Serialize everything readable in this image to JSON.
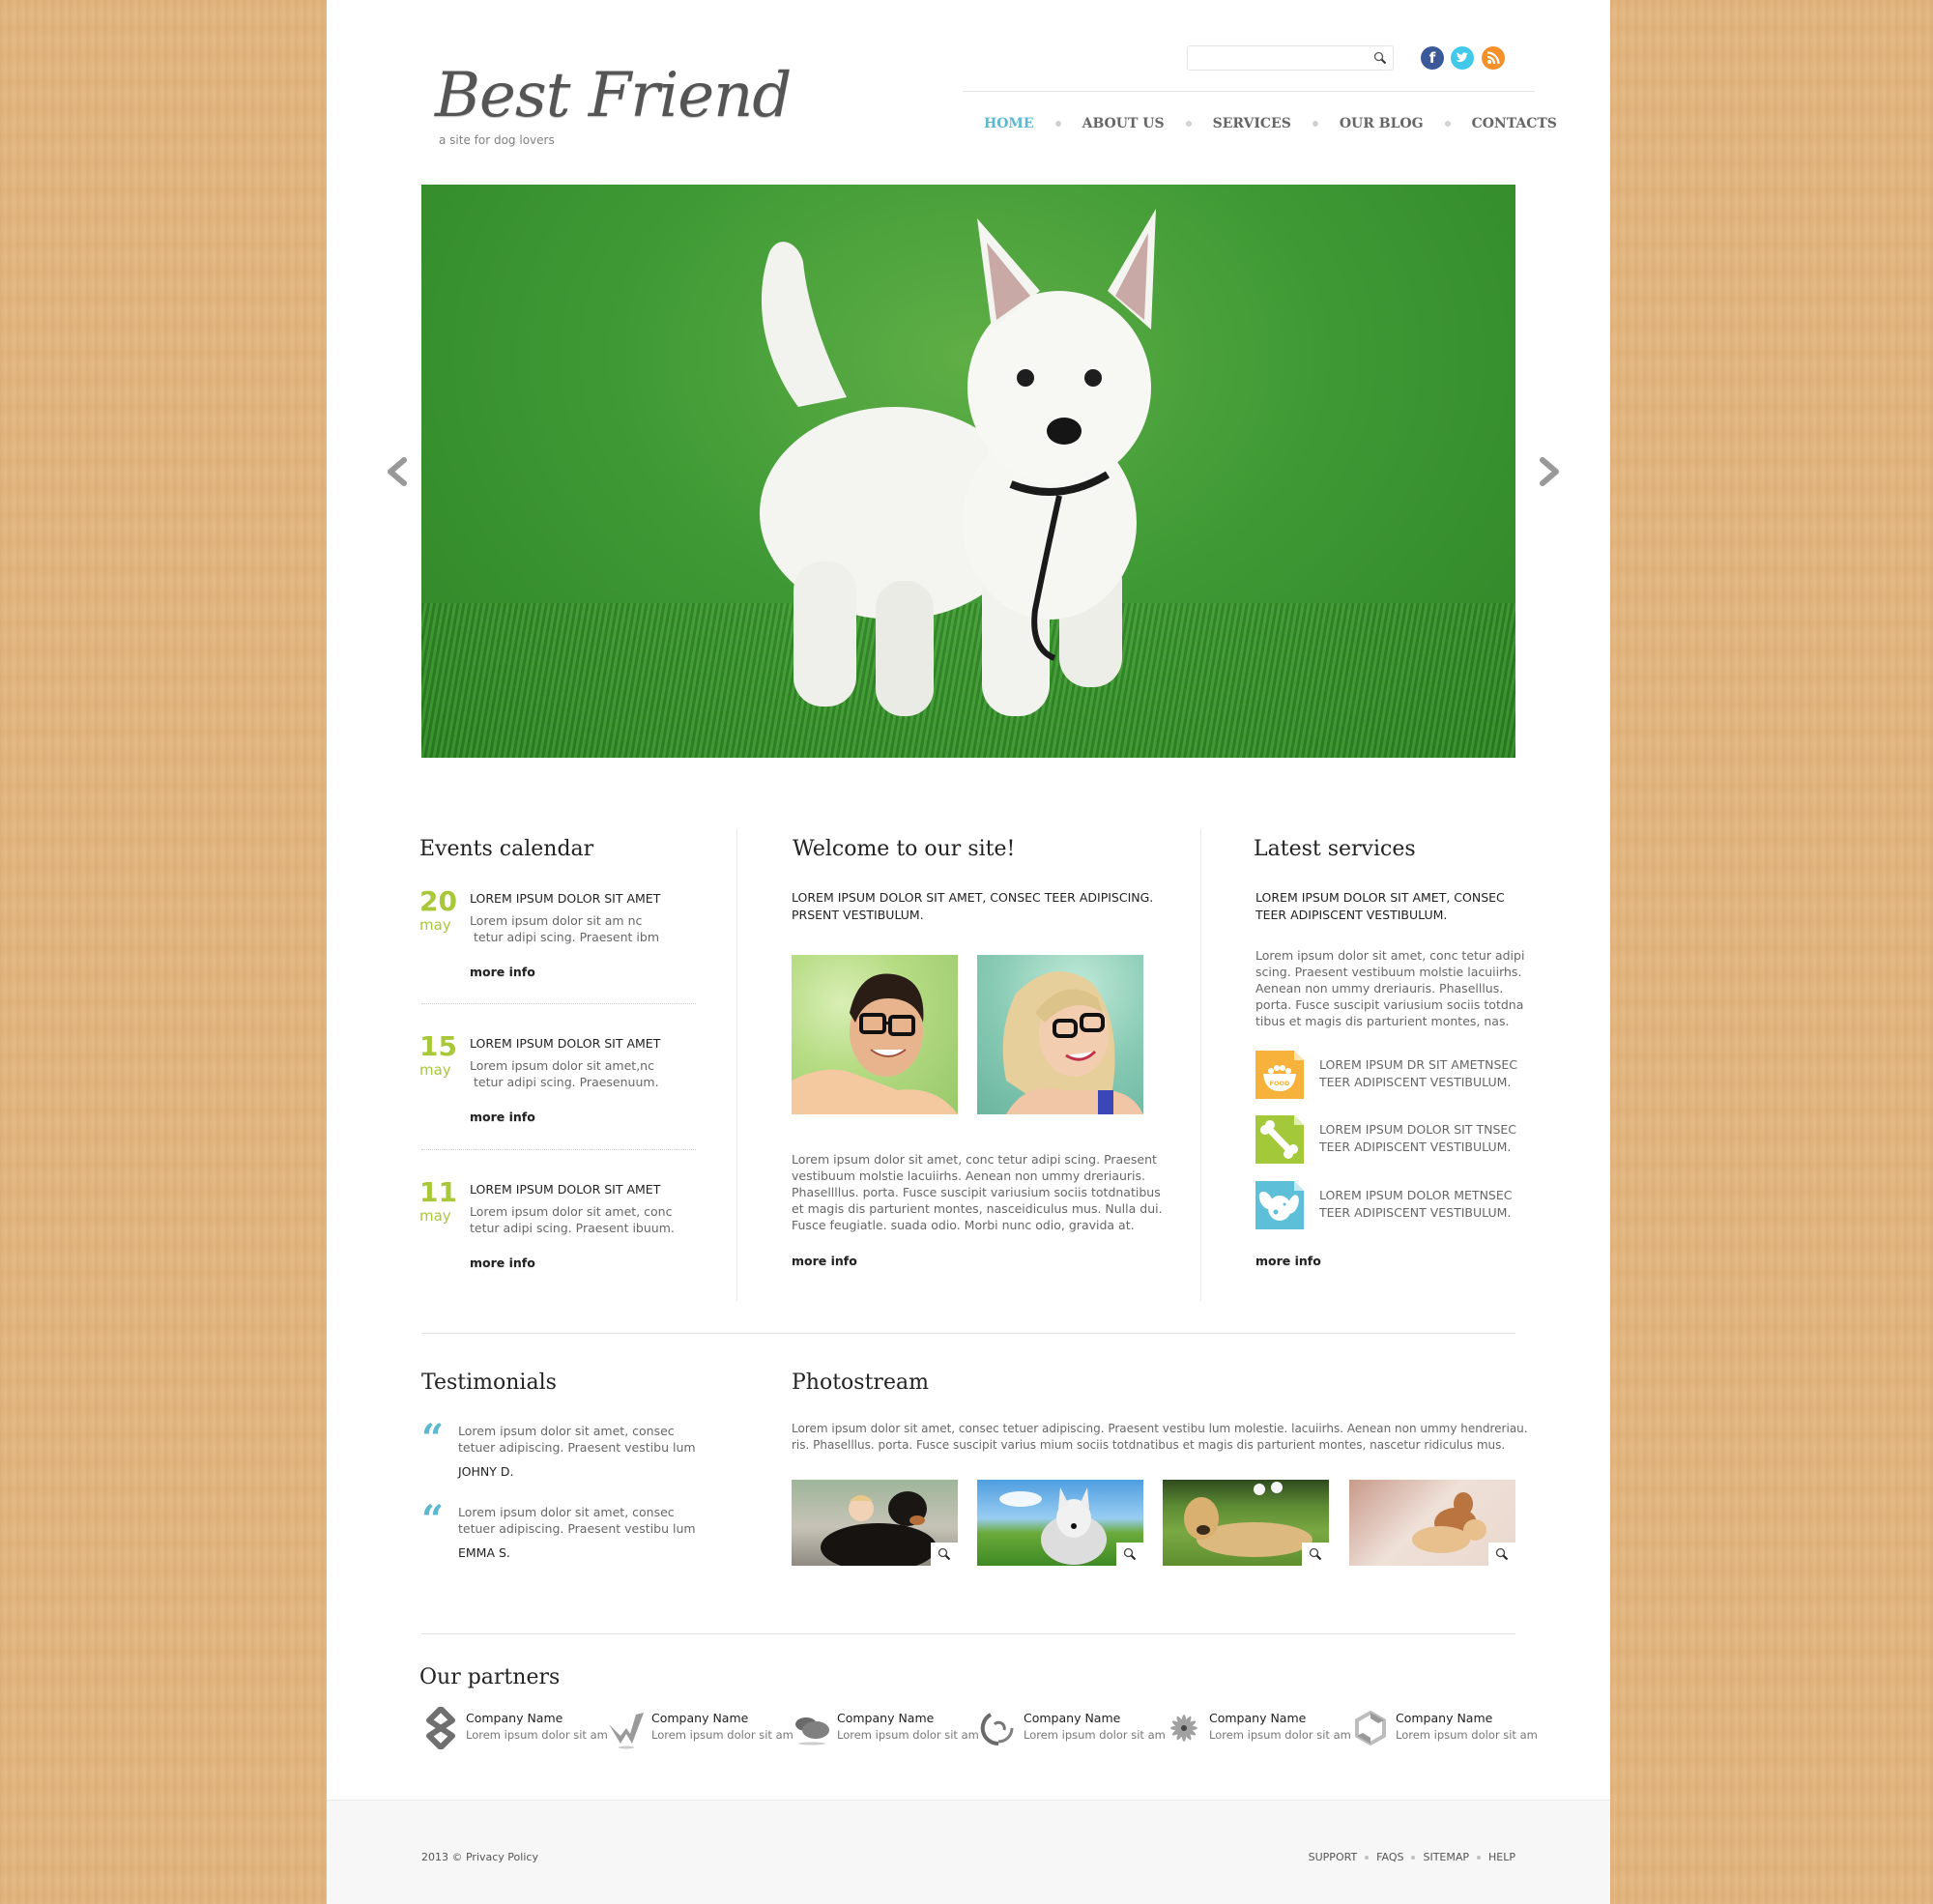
{
  "header": {
    "logo_title": "Best Friend",
    "logo_tagline": "a site for dog lovers",
    "search": {
      "value": "",
      "placeholder": ""
    },
    "social": [
      {
        "name": "facebook",
        "glyph": "f",
        "color": "#3b5998"
      },
      {
        "name": "twitter",
        "glyph": "t",
        "color": "#42c9ea"
      },
      {
        "name": "rss",
        "glyph": "rss",
        "color": "#f5902a"
      }
    ],
    "nav": [
      {
        "label": "HOME",
        "active": true
      },
      {
        "label": "ABOUT US",
        "active": false
      },
      {
        "label": "SERVICES",
        "active": false
      },
      {
        "label": "OUR BLOG",
        "active": false
      },
      {
        "label": "CONTACTS",
        "active": false
      }
    ]
  },
  "slider": {
    "image": "white west highland terrier puppy on grass",
    "prev_icon": "chevron-left-icon",
    "next_icon": "chevron-right-icon"
  },
  "events": {
    "title": "Events calendar",
    "items": [
      {
        "day": "20",
        "month": "may",
        "title": "LOREM IPSUM DOLOR SIT AMET",
        "text_line1": "Lorem ipsum dolor sit am nc",
        "text_line2": " tetur adipi scing. Praesent ibm",
        "link": "more info"
      },
      {
        "day": "15",
        "month": "may",
        "title": "LOREM IPSUM DOLOR SIT AMET",
        "text_line1": "Lorem ipsum dolor sit amet,nc",
        "text_line2": " tetur adipi scing. Praesenuum.",
        "link": "more info"
      },
      {
        "day": "11",
        "month": "may",
        "title": "LOREM IPSUM DOLOR SIT AMET",
        "text_line1": "Lorem ipsum dolor sit amet, conc",
        "text_line2": "tetur adipi scing. Praesent ibuum.",
        "link": "more info"
      }
    ]
  },
  "welcome": {
    "title": "Welcome to our site!",
    "intro_line1": "LOREM IPSUM DOLOR SIT AMET, CONSEC TEER ADIPISCING.",
    "intro_line2": "PRSENT VESTIBULUM.",
    "photos": [
      "smiling man with glasses",
      "smiling blonde woman with glasses"
    ],
    "body_lines": [
      "Lorem ipsum dolor sit amet, conc tetur adipi scing. Praesent",
      "vestibuum molstie lacuiirhs. Aenean non ummy dreriauris.",
      "Phasellllus. porta. Fusce suscipit variusium sociis totdnatibus",
      "et magis dis parturient montes, nasceidiculus mus. Nulla dui.",
      "Fusce feugiatle. suada odio. Morbi nunc odio, gravida at."
    ],
    "link": "more info"
  },
  "services": {
    "title": "Latest services",
    "intro_line1": "LOREM IPSUM DOLOR SIT AMET, CONSEC",
    "intro_line2": "TEER ADIPISCENT VESTIBULUM.",
    "body_lines": [
      "Lorem ipsum dolor sit amet, conc tetur adipi",
      "scing. Praesent vestibuum molstie lacuiirhs.",
      "Aenean non ummy dreriauris. Phaselllus.",
      "porta. Fusce suscipit variusium sociis totdna",
      "tibus et magis dis parturient montes, nas."
    ],
    "items": [
      {
        "icon": "food-bowl-icon",
        "color": "#f7b23b",
        "line1": "LOREM IPSUM DR SIT AMETNSEC",
        "line2": "TEER ADIPISCENT VESTIBULUM."
      },
      {
        "icon": "bone-icon",
        "color": "#a3c93a",
        "line1": "LOREM IPSUM DOLOR SIT TNSEC",
        "line2": "TEER ADIPISCENT VESTIBULUM."
      },
      {
        "icon": "dog-face-icon",
        "color": "#5ebfd9",
        "line1": "LOREM IPSUM DOLOR METNSEC",
        "line2": "TEER ADIPISCENT VESTIBULUM."
      }
    ],
    "link": "more info",
    "food_label": "FOOD"
  },
  "testimonials": {
    "title": "Testimonials",
    "items": [
      {
        "line1": "Lorem ipsum dolor sit amet, consec",
        "line2": "tetuer adipiscing. Praesent vestibu lum",
        "author": "JOHNY D."
      },
      {
        "line1": "Lorem ipsum dolor sit amet, consec",
        "line2": "tetuer adipiscing. Praesent vestibu lum",
        "author": "EMMA S."
      }
    ]
  },
  "photostream": {
    "title": "Photostream",
    "line1": "Lorem ipsum dolor sit amet, consec tetuer adipiscing. Praesent vestibu lum molestie. lacuiirhs. Aenean non ummy hendreriau.",
    "line2": "ris. Phaselllus. porta. Fusce suscipit varius mium sociis totdnatibus et magis dis parturient montes, nascetur ridiculus mus.",
    "thumbs": [
      "child hugging rottweiler",
      "husky puppy on grass",
      "labrador lying in grass",
      "two dachshund puppies"
    ]
  },
  "partners": {
    "title": "Our partners",
    "items": [
      {
        "name": "Company Name",
        "desc": "Lorem ipsum dolor sit am"
      },
      {
        "name": "Company Name",
        "desc": "Lorem ipsum dolor sit am"
      },
      {
        "name": "Company Name",
        "desc": "Lorem ipsum dolor sit am"
      },
      {
        "name": "Company Name",
        "desc": "Lorem ipsum dolor sit am"
      },
      {
        "name": "Company Name",
        "desc": "Lorem ipsum dolor sit am"
      },
      {
        "name": "Company Name",
        "desc": "Lorem ipsum dolor sit am"
      }
    ]
  },
  "footer": {
    "copyright": "2013 © Privacy Policy",
    "links": [
      "SUPPORT",
      "FAQS",
      "SITEMAP",
      "HELP"
    ]
  },
  "colors": {
    "accent_blue": "#5cb8cf",
    "accent_green": "#a8c83a",
    "wood": "#e2b47c"
  }
}
